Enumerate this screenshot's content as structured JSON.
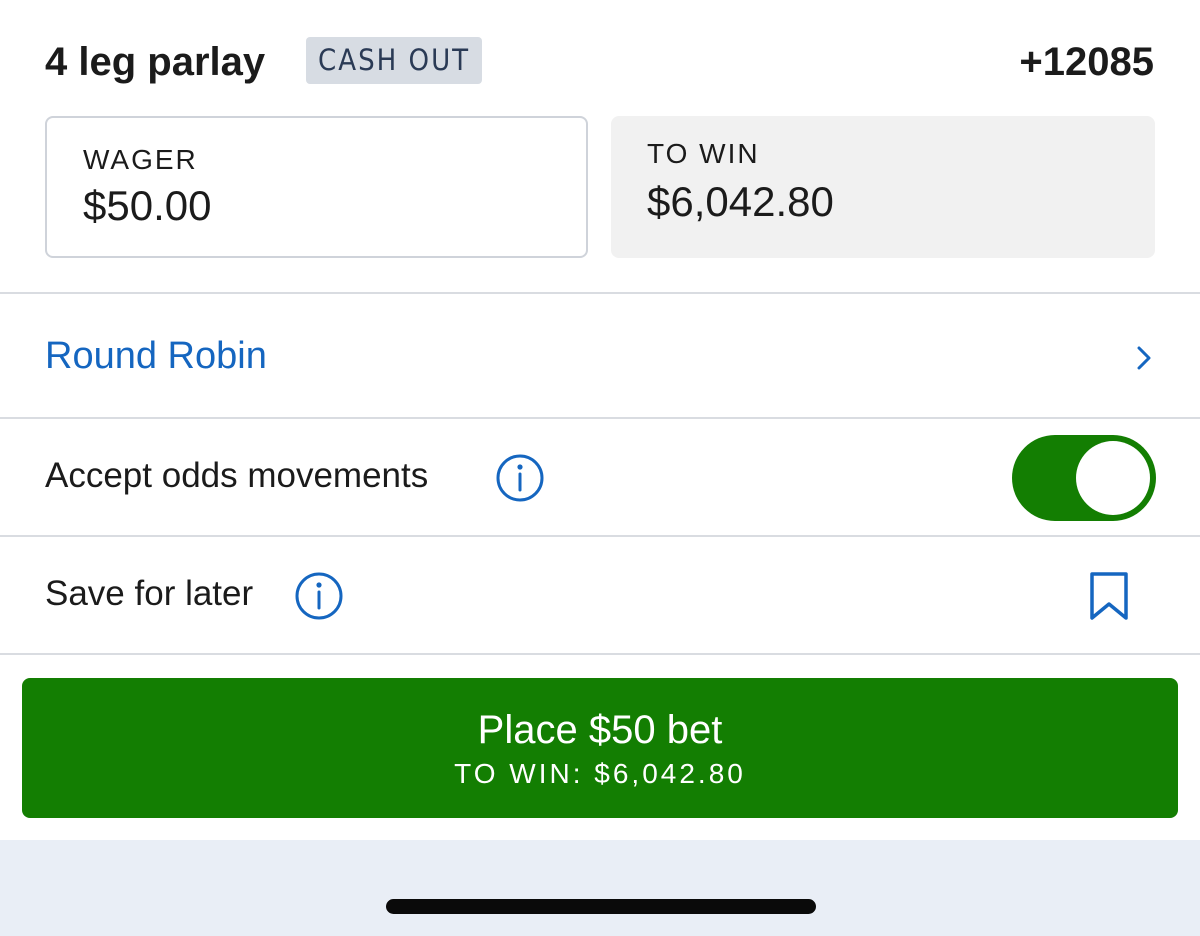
{
  "bet": {
    "title": "4 leg parlay",
    "badge": "CASH OUT",
    "odds": "+12085"
  },
  "wager": {
    "label": "WAGER",
    "value": "$50.00"
  },
  "to_win": {
    "label": "TO WIN",
    "value": "$6,042.80"
  },
  "round_robin": {
    "label": "Round Robin",
    "icon": "chevron-right-icon"
  },
  "accept_odds": {
    "label": "Accept odds movements",
    "info_icon": "info-icon",
    "toggle_on": true
  },
  "save_for_later": {
    "label": "Save for later",
    "info_icon": "info-icon",
    "bookmark_icon": "bookmark-icon"
  },
  "place_button": {
    "label": "Place $50 bet",
    "sublabel": "TO WIN: $6,042.80"
  },
  "colors": {
    "accent_blue": "#1566c0",
    "action_green": "#137e02",
    "badge_bg": "#d7dce3",
    "footer_bg": "#e9eef6"
  }
}
